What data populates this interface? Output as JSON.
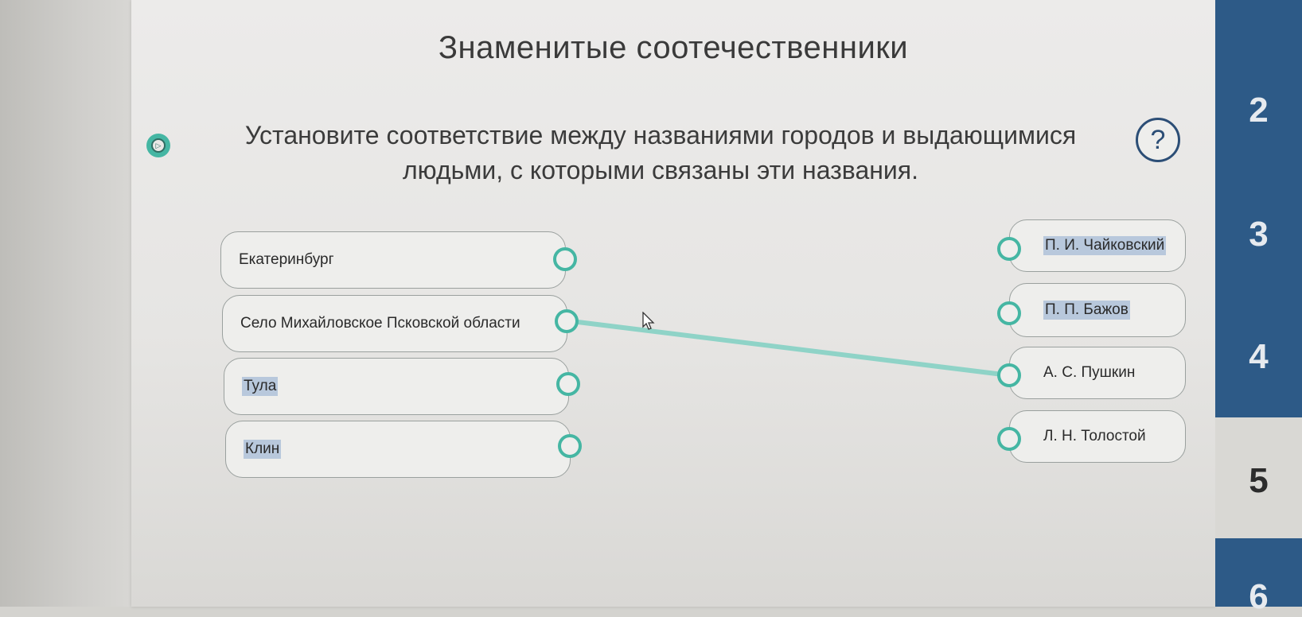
{
  "title": "Знаменитые соотечественники",
  "instruction": {
    "line1": "Установите соответствие между названиями городов и выдающимися",
    "line2": "людьми, с которыми связаны эти названия."
  },
  "help_label": "?",
  "left_items": [
    "Екатеринбург",
    "Село Михайловское Псковской области",
    "Тула",
    "Клин"
  ],
  "right_items": [
    "П. И. Чайковский",
    "П. П. Бажов",
    "А. С. Пушкин",
    "Л. Н. Толостой"
  ],
  "connections": [
    {
      "from": 1,
      "to": 2
    }
  ],
  "side_nav": [
    "2",
    "3",
    "4",
    "5",
    "6"
  ],
  "colors": {
    "accent": "#45b6a3",
    "nav": "#2d5a87",
    "link": "#8fd3c7"
  }
}
